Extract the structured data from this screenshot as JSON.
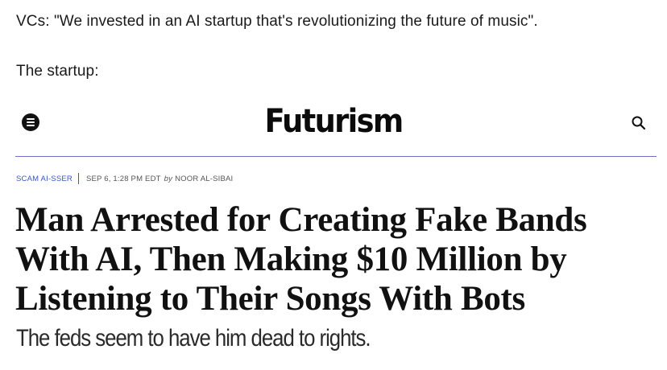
{
  "post": {
    "line1": "VCs: \"We invested in an AI startup that's revolutionizing the future of music\".",
    "line2": "The startup:"
  },
  "site": {
    "logo": "Futurism",
    "icons": {
      "menu": "menu-icon",
      "search": "search-icon"
    }
  },
  "article": {
    "category": "SCAM AI-SSER",
    "date": "SEP 6, 1:28 PM EDT",
    "by": "by",
    "author": "NOOR AL-SIBAI",
    "headline_lines": [
      "Man Arrested for Creating Fake Bands",
      "With AI, Then Making $10 Million by",
      "Listening to Their Songs With Bots"
    ],
    "dek": "The feds seem to have him dead to rights."
  },
  "colors": {
    "divider": "#6b72c7",
    "category": "#3a55c7",
    "text": "#111111"
  }
}
